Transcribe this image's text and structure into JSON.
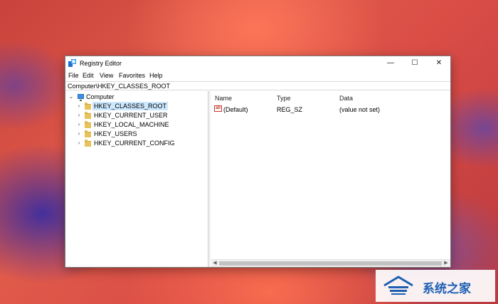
{
  "window": {
    "title": "Registry Editor",
    "controls": {
      "minimize": "—",
      "maximize": "☐",
      "close": "✕"
    },
    "icon": "registry-editor-icon"
  },
  "menu": [
    "File",
    "Edit",
    "View",
    "Favorites",
    "Help"
  ],
  "address": "Computer\\HKEY_CLASSES_ROOT",
  "tree": {
    "root": "Computer",
    "keys": [
      "HKEY_CLASSES_ROOT",
      "HKEY_CURRENT_USER",
      "HKEY_LOCAL_MACHINE",
      "HKEY_USERS",
      "HKEY_CURRENT_CONFIG"
    ],
    "selected": "HKEY_CLASSES_ROOT"
  },
  "list": {
    "columns": [
      "Name",
      "Type",
      "Data"
    ],
    "rows": [
      {
        "name": "(Default)",
        "type": "REG_SZ",
        "data": "(value not set)",
        "icon": "ab",
        "icon_name": "string-value-icon"
      }
    ]
  },
  "watermark": {
    "text": "系统之家"
  },
  "colors": {
    "selection": "#cce8ff",
    "folder": "#e8c25a",
    "accent": "#1e5fb3"
  }
}
